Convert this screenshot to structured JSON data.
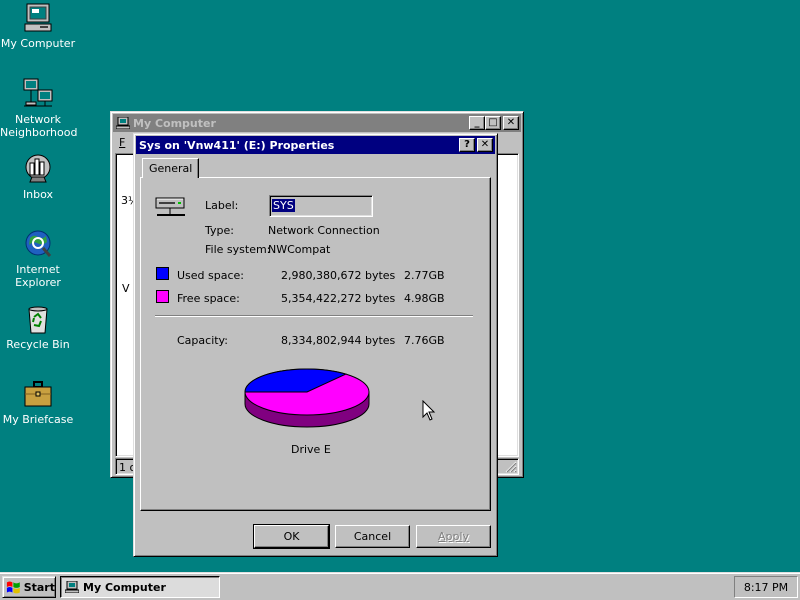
{
  "desktop": {
    "icons": [
      {
        "label": "My Computer"
      },
      {
        "label": "Network Neighborhood"
      },
      {
        "label": "Inbox"
      },
      {
        "label": "Internet Explorer"
      },
      {
        "label": "Recycle Bin"
      },
      {
        "label": "My Briefcase"
      }
    ]
  },
  "bg_window": {
    "title": "My Computer",
    "menu_first": "F",
    "left_fragment_1": "3½",
    "left_fragment_2": "V",
    "status_fragment": "1 o",
    "buttons": {
      "minimize": "_",
      "maximize": "□",
      "close": "✕"
    }
  },
  "dialog": {
    "title": "Sys on 'Vnw411' (E:) Properties",
    "help_button": "?",
    "close_button": "✕",
    "tab_general": "General",
    "label_caption": "Label:",
    "label_value": "SYS",
    "type_caption": "Type:",
    "type_value": "Network Connection",
    "fs_caption": "File system:",
    "fs_value": "NWCompat",
    "used_caption": "Used space:",
    "used_bytes": "2,980,380,672 bytes",
    "used_gb": "2.77GB",
    "free_caption": "Free space:",
    "free_bytes": "5,354,422,272 bytes",
    "free_gb": "4.98GB",
    "capacity_caption": "Capacity:",
    "capacity_bytes": "8,334,802,944 bytes",
    "capacity_gb": "7.76GB",
    "drive_caption": "Drive E",
    "used_color": "#0000ff",
    "free_color": "#ff00ff",
    "used_fraction": 0.3576,
    "ok_label": "OK",
    "cancel_label": "Cancel",
    "apply_label": "Apply"
  },
  "taskbar": {
    "start_label": "Start",
    "task_label": "My Computer",
    "clock": "8:17 PM"
  }
}
